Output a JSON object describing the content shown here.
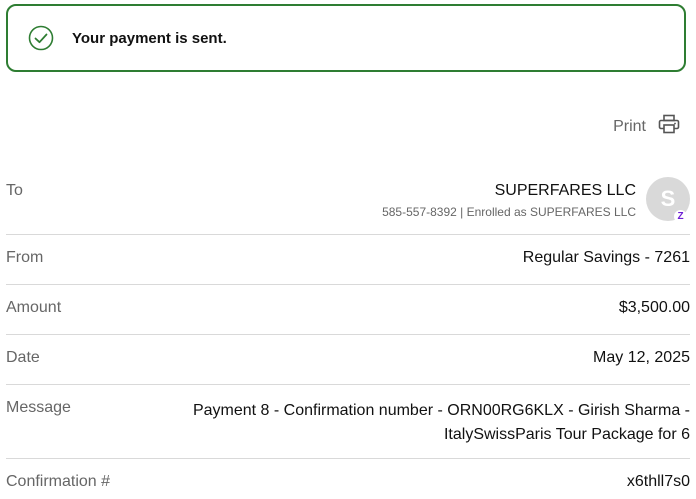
{
  "banner": {
    "message": "Your payment is sent.",
    "icon": "check-circle-icon",
    "accent": "#2e7d32"
  },
  "print": {
    "label": "Print",
    "icon": "printer-icon"
  },
  "details": {
    "to": {
      "label": "To",
      "name": "SUPERFARES LLC",
      "sub": "585-557-8392 | Enrolled as SUPERFARES LLC",
      "avatar_initial": "S",
      "badge": "Z"
    },
    "from": {
      "label": "From",
      "value": "Regular Savings - 7261"
    },
    "amount": {
      "label": "Amount",
      "value": "$3,500.00"
    },
    "date": {
      "label": "Date",
      "value": "May 12, 2025"
    },
    "message": {
      "label": "Message",
      "value": "Payment 8 - Confirmation number - ORN00RG6KLX - Girish Sharma - ItalySwissParis Tour Package for 6"
    },
    "confirmation": {
      "label": "Confirmation #",
      "value": "x6thll7s0"
    }
  }
}
